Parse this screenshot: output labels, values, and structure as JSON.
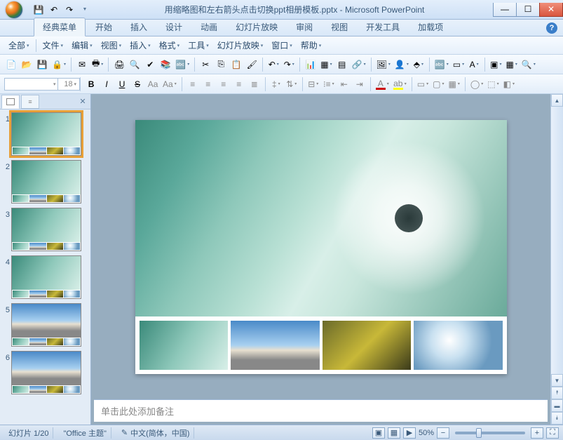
{
  "titlebar": {
    "title": "用缩略图和左右箭头点击切换ppt相册模板.pptx - Microsoft PowerPoint"
  },
  "ribbon_tabs": {
    "items": [
      "经典菜单",
      "开始",
      "插入",
      "设计",
      "动画",
      "幻灯片放映",
      "审阅",
      "视图",
      "开发工具",
      "加载项"
    ],
    "active_index": 0
  },
  "menu_row": {
    "items": [
      "全部",
      "文件",
      "编辑",
      "视图",
      "插入",
      "格式",
      "工具",
      "幻灯片放映",
      "窗口",
      "帮助"
    ]
  },
  "format_bar": {
    "font_size": "18",
    "bold": "B",
    "italic": "I",
    "underline": "U",
    "strike": "S",
    "shadow": "Aa"
  },
  "thumbnails": {
    "selected": 1,
    "items": [
      {
        "n": "1",
        "type": "teal"
      },
      {
        "n": "2",
        "type": "teal"
      },
      {
        "n": "3",
        "type": "teal"
      },
      {
        "n": "4",
        "type": "teal"
      },
      {
        "n": "5",
        "type": "sky"
      },
      {
        "n": "6",
        "type": "sky"
      }
    ]
  },
  "notes": {
    "placeholder": "单击此处添加备注"
  },
  "statusbar": {
    "slide_info": "幻灯片 1/20",
    "theme": "\"Office 主题\"",
    "lang": "中文(简体，中国)",
    "zoom": "50%"
  },
  "icons": {
    "save": "💾",
    "undo": "↶",
    "redo": "↷",
    "new": "📄",
    "open": "📂",
    "save2": "💾",
    "mail": "✉",
    "print": "🖨",
    "preview": "🔍",
    "spell": "✔",
    "cut": "✂",
    "copy": "⎘",
    "paste": "📋",
    "fmtpaint": "🖌",
    "chart": "📊",
    "table": "▦",
    "hyperlink": "🔗",
    "picture": "🖼",
    "clipart": "👤",
    "shape": "◯",
    "textbox": "🔤",
    "align_l": "≡",
    "align_c": "≡",
    "align_r": "≡",
    "bullets": "•",
    "numbers": "1",
    "indent_dec": "◀",
    "indent_inc": "▶",
    "fontcolor": "A",
    "highlight": "A",
    "design": "▭",
    "newslide": "▢",
    "layout": "▦"
  }
}
